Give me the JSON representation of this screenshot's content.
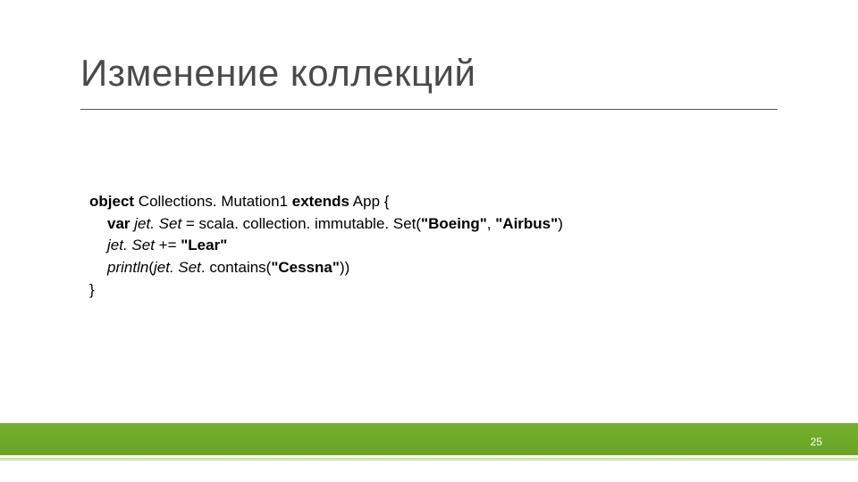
{
  "title": "Изменение коллекций",
  "code": {
    "l1": {
      "kw1": "object",
      "name": " Collections. Mutation1 ",
      "kw2": "extends",
      "tail": " App {"
    },
    "l2": {
      "kw": "var",
      "ital": " jet. Set",
      "mid": " = scala. collection. immutable. Set(",
      "s1": "\"Boeing\"",
      "comma": ", ",
      "s2": "\"Airbus\"",
      "close": ")"
    },
    "l3": {
      "ital": "jet. Set ",
      "op": "+= ",
      "s": "\"Lear\""
    },
    "l4": {
      "ital1": "println",
      "open": "(",
      "ital2": "jet. Set",
      "mid": ". contains(",
      "s": "\"Cessna\"",
      "close": "))"
    },
    "l5": "}"
  },
  "page": "25"
}
